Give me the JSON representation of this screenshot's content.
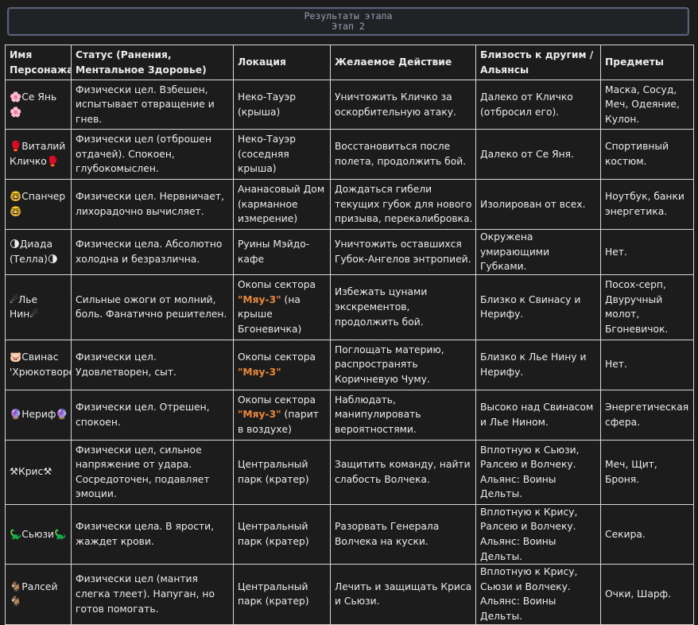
{
  "header": {
    "title": "Результаты этапа",
    "subtitle": "Этап 2"
  },
  "table": {
    "columns": [
      "Имя Персонажа",
      "Статус (Ранения, Ментальное Здоровье)",
      "Локация",
      "Желаемое Действие",
      "Близость к другим / Альянсы",
      "Предметы"
    ],
    "rows": [
      {
        "name": "🌸Се Янь🌸",
        "status": "Физически цел. Взбешен, испытывает отвращение и гнев.",
        "location": "Неко-Тауэр (крыша)",
        "action": "Уничтожить Кличко за оскорбительную атаку.",
        "proximity": "Далеко от Кличко (отбросил его).",
        "items": "Маска, Сосуд, Меч, Одеяние, Кулон."
      },
      {
        "name": "🥊Виталий Кличко🥊",
        "status": "Физически цел (отброшен отдачей). Спокоен, глубокомыслен.",
        "location": "Неко-Тауэр (соседняя крыша)",
        "action": "Восстановиться после полета, продолжить бой.",
        "proximity": "Далеко от Се Яня.",
        "items": "Спортивный костюм."
      },
      {
        "name": "🤓Спанчер🤓",
        "status": "Физически цел. Нервничает, лихорадочно вычисляет.",
        "location": "Ананасовый Дом (карманное измерение)",
        "action": "Дождаться гибели текущих губок для нового призыва, перекалибровка.",
        "proximity": "Изолирован от всех.",
        "items": "Ноутбук, банки энергетика."
      },
      {
        "name": "🌗Диада (Телла)🌗",
        "status": "Физически цела. Абсолютно холодна и безразлична.",
        "location": "Руины Мэйдо-кафе",
        "action": "Уничтожить оставшихся Губок-Ангелов энтропией.",
        "proximity": "Окружена умирающими Губками.",
        "items": "Нет."
      },
      {
        "name": "☄Лье Нин☄",
        "status": "Сильные ожоги от молний, боль. Фанатично решителен.",
        "location_pre": "Окопы сектора",
        "location_hl": "\"Мяу-3\"",
        "location_post": " (на крыше Бгоневичка)",
        "action": "Избежать цунами экскрементов, продолжить бой.",
        "proximity": "Близко к Свинасу и Нерифу.",
        "items": "Посох-серп, Двуручный молот, Бгоневичок."
      },
      {
        "name": "🐷Свинас 'Хрюкотворец'🐷",
        "status": "Физически цел. Удовлетворен, сыт.",
        "location_pre": "Окопы сектора",
        "location_hl": "\"Мяу-3\"",
        "location_post": "",
        "action": "Поглощать материю, распространять Коричневую Чуму.",
        "proximity": "Близко к Лье Нину и Нерифу.",
        "items": "Нет."
      },
      {
        "name": "🔮Нериф🔮",
        "status": "Физически цел. Отрешен, спокоен.",
        "location_pre": "Окопы сектора",
        "location_hl": "\"Мяу-3\"",
        "location_post": " (парит в воздухе)",
        "action": "Наблюдать, манипулировать вероятностями.",
        "proximity": "Высоко над Свинасом и Лье Нином.",
        "items": "Энергетическая сфера."
      },
      {
        "name": "⚒Крис⚒",
        "status": "Физически цел, сильное напряжение от удара. Сосредоточен, подавляет эмоции.",
        "location": "Центральный парк (кратер)",
        "action": "Защитить команду, найти слабость Волчека.",
        "proximity": "Вплотную к Сьюзи, Ралсею и Волчеку. Альянс: Воины Дельты.",
        "items": "Меч, Щит, Броня."
      },
      {
        "name": "🦕Сьюзи🦕",
        "status": "Физически цела. В ярости, жаждет крови.",
        "location": "Центральный парк (кратер)",
        "action": "Разорвать Генерала Волчека на куски.",
        "proximity": "Вплотную к Крису, Ралсею и Волчеку. Альянс: Воины Дельты.",
        "items": "Секира."
      },
      {
        "name": "🐐Ралсей🐐",
        "status": "Физически цел (мантия слегка тлеет). Напуган, но готов помогать.",
        "location": "Центральный парк (кратер)",
        "action": "Лечить и защищать Криса и Сьюзи.",
        "proximity": "Вплотную к Крису, Сьюзи и Волчеку. Альянс: Воины Дельты.",
        "items": "Очки, Шарф."
      }
    ]
  }
}
